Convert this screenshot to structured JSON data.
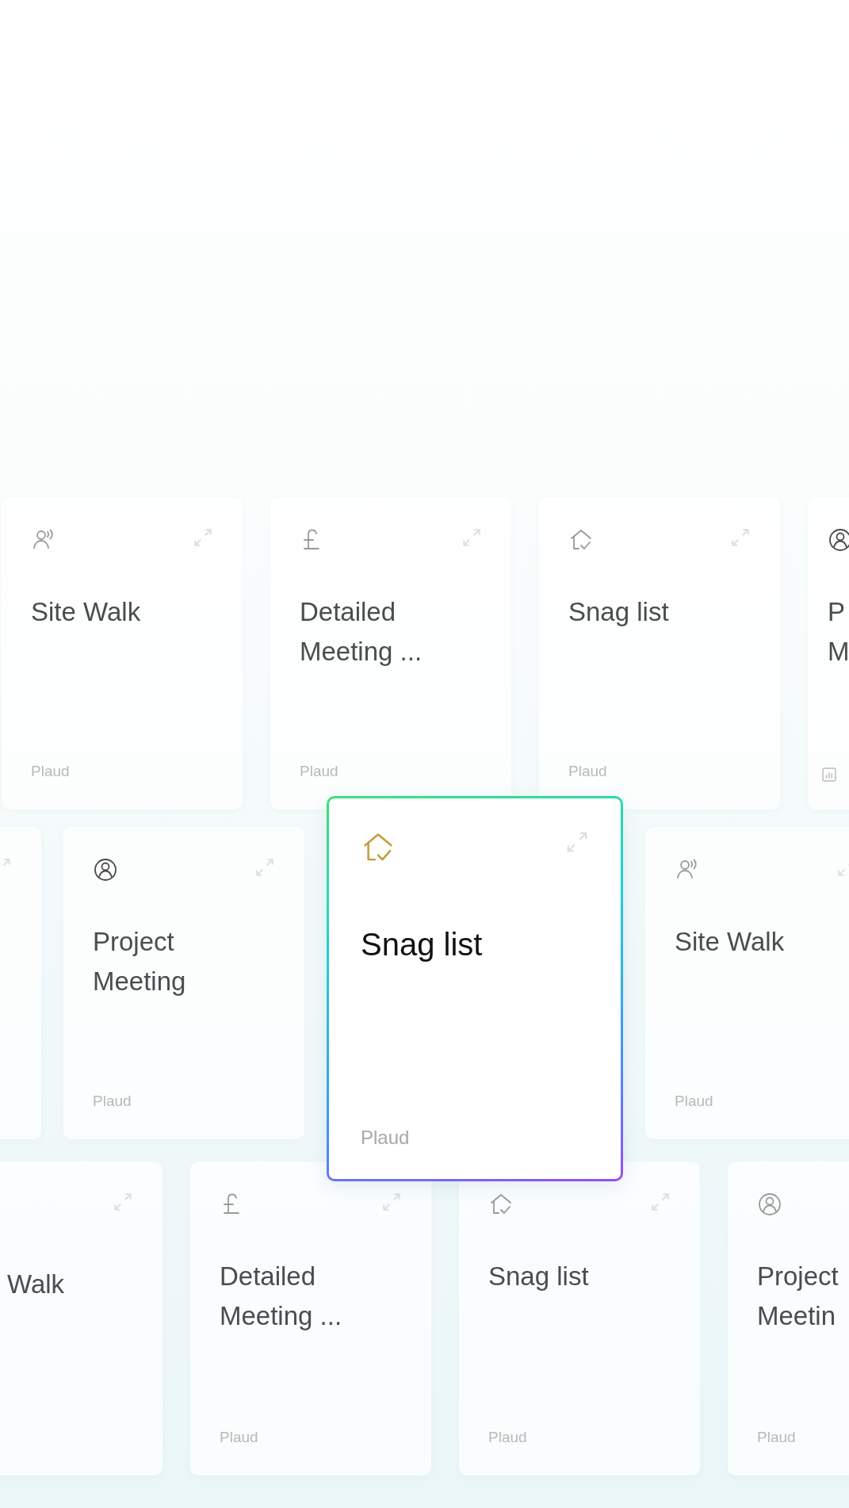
{
  "rows": [
    {
      "cards": [
        {
          "kind": "walk",
          "title": [
            "Site Walk"
          ],
          "footer": "Plaud",
          "selected": false
        },
        {
          "kind": "finance",
          "title": [
            "Detailed",
            "Meeting ..."
          ],
          "footer": "Plaud",
          "selected": false
        },
        {
          "kind": "snag",
          "title": [
            "Snag list"
          ],
          "footer": "Plaud",
          "selected": false
        },
        {
          "kind": "meeting",
          "title": [
            "P",
            "M"
          ],
          "has_stats": true,
          "selected": false
        }
      ]
    },
    {
      "cards": [
        {
          "selected": false
        },
        {
          "kind": "meeting",
          "title": [
            "Project",
            "Meeting"
          ],
          "footer": "Plaud",
          "selected": false
        },
        {
          "kind": "snag",
          "title": [
            "Snag list"
          ],
          "footer": "Plaud",
          "selected": true
        },
        {
          "kind": "walk",
          "title": [
            "Site Walk"
          ],
          "footer": "Plaud",
          "selected": false
        }
      ]
    },
    {
      "cards": [
        {
          "title": [
            "Walk"
          ],
          "selected": false
        },
        {
          "kind": "finance",
          "title": [
            "Detailed",
            "Meeting ..."
          ],
          "footer": "Plaud",
          "selected": false
        },
        {
          "kind": "snag",
          "title": [
            "Snag list"
          ],
          "footer": "Plaud",
          "selected": false
        },
        {
          "kind": "meeting",
          "title": [
            "Project",
            "Meetin"
          ],
          "footer": "Plaud",
          "selected": false
        }
      ]
    }
  ]
}
